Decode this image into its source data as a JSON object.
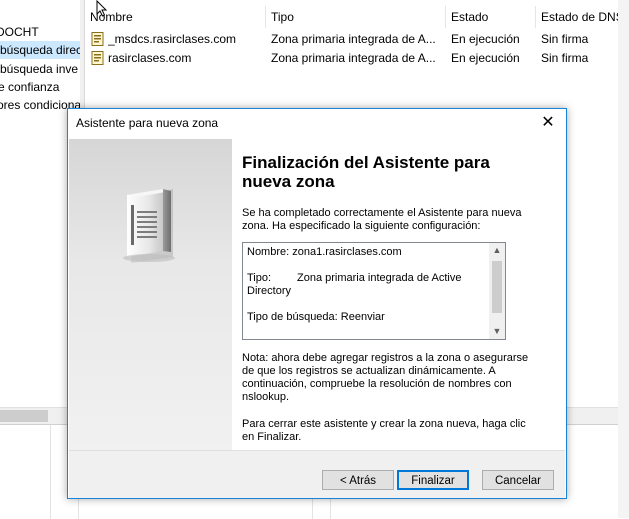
{
  "tree": {
    "items": [
      {
        "label": "DOCHT",
        "selected": false
      },
      {
        "label": "búsqueda direc",
        "selected": true
      },
      {
        "label": "búsqueda inve",
        "selected": false
      },
      {
        "label": "e confianza",
        "selected": false
      },
      {
        "label": "ores condiciona",
        "selected": false
      }
    ]
  },
  "list": {
    "columns": [
      "Nombre",
      "Tipo",
      "Estado",
      "Estado de DNSSE"
    ],
    "rows": [
      {
        "name": "_msdcs.rasirclases.com",
        "type": "Zona primaria integrada de A...",
        "status": "En ejecución",
        "dnssec": "Sin firma"
      },
      {
        "name": "rasirclases.com",
        "type": "Zona primaria integrada de A...",
        "status": "En ejecución",
        "dnssec": "Sin firma"
      }
    ]
  },
  "dialog": {
    "title": "Asistente para nueva zona",
    "close_glyph": "✕",
    "heading": "Finalización del Asistente para nueva zona",
    "intro": "Se ha completado correctamente el Asistente para nueva zona. Ha especificado la siguiente configuración:",
    "summary": {
      "name_line": "Nombre:  zona1.rasirclases.com",
      "type_label": "Tipo:",
      "type_value": "Zona primaria integrada de Active",
      "type_value_cont": "Directory",
      "lookup_line": "Tipo de búsqueda:  Reenviar"
    },
    "note": "Nota: ahora debe agregar registros a la zona o asegurarse de que los registros se actualizan dinámicamente. A continuación, compruebe la resolución de nombres con nslookup.",
    "finish_text": "Para cerrar este asistente y crear la zona nueva, haga clic en Finalizar.",
    "buttons": {
      "back": "< Atrás",
      "finish": "Finalizar",
      "cancel": "Cancelar"
    },
    "scroll_up": "▲",
    "scroll_down": "▼"
  },
  "colors": {
    "accent": "#0078d7",
    "selection": "#cce8ff",
    "dialog_border": "#1883d7"
  }
}
